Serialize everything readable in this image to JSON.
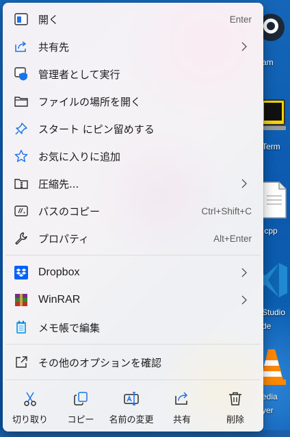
{
  "menu": {
    "items": [
      {
        "label": "開く",
        "accelerator": "Enter",
        "icon": "open-window-icon"
      },
      {
        "label": "共有先",
        "icon": "share-icon",
        "has_submenu": true
      },
      {
        "label": "管理者として実行",
        "icon": "shield-admin-icon"
      },
      {
        "label": "ファイルの場所を開く",
        "icon": "folder-icon"
      },
      {
        "label": "スタート にピン留めする",
        "icon": "pin-icon"
      },
      {
        "label": "お気に入りに追加",
        "icon": "star-icon"
      },
      {
        "label": "圧縮先...",
        "icon": "zip-folder-icon",
        "has_submenu": true
      },
      {
        "label": "パスのコピー",
        "accelerator": "Ctrl+Shift+C",
        "icon": "copy-path-icon"
      },
      {
        "label": "プロパティ",
        "accelerator": "Alt+Enter",
        "icon": "wrench-icon"
      },
      {
        "label": "Dropbox",
        "icon": "dropbox-icon",
        "has_submenu": true
      },
      {
        "label": "WinRAR",
        "icon": "winrar-icon",
        "has_submenu": true
      },
      {
        "label": "メモ帳で編集",
        "icon": "notepad-icon"
      },
      {
        "label": "その他のオプションを確認",
        "icon": "external-options-icon"
      }
    ],
    "toolbar": [
      {
        "label": "切り取り",
        "icon": "scissors-icon"
      },
      {
        "label": "コピー",
        "icon": "copy-icon"
      },
      {
        "label": "名前の変更",
        "icon": "rename-icon"
      },
      {
        "label": "共有",
        "icon": "share-icon"
      },
      {
        "label": "削除",
        "icon": "trash-icon"
      }
    ]
  },
  "desktop": {
    "labels": [
      "am",
      "Term",
      ".cpp",
      "Studio",
      "de",
      "edia",
      "yer"
    ]
  },
  "colors": {
    "accent_blue": "#0067c0",
    "dropbox_blue": "#0061fe",
    "menu_text": "#1b1b1b",
    "accelerator_text": "#5c5c5c"
  }
}
